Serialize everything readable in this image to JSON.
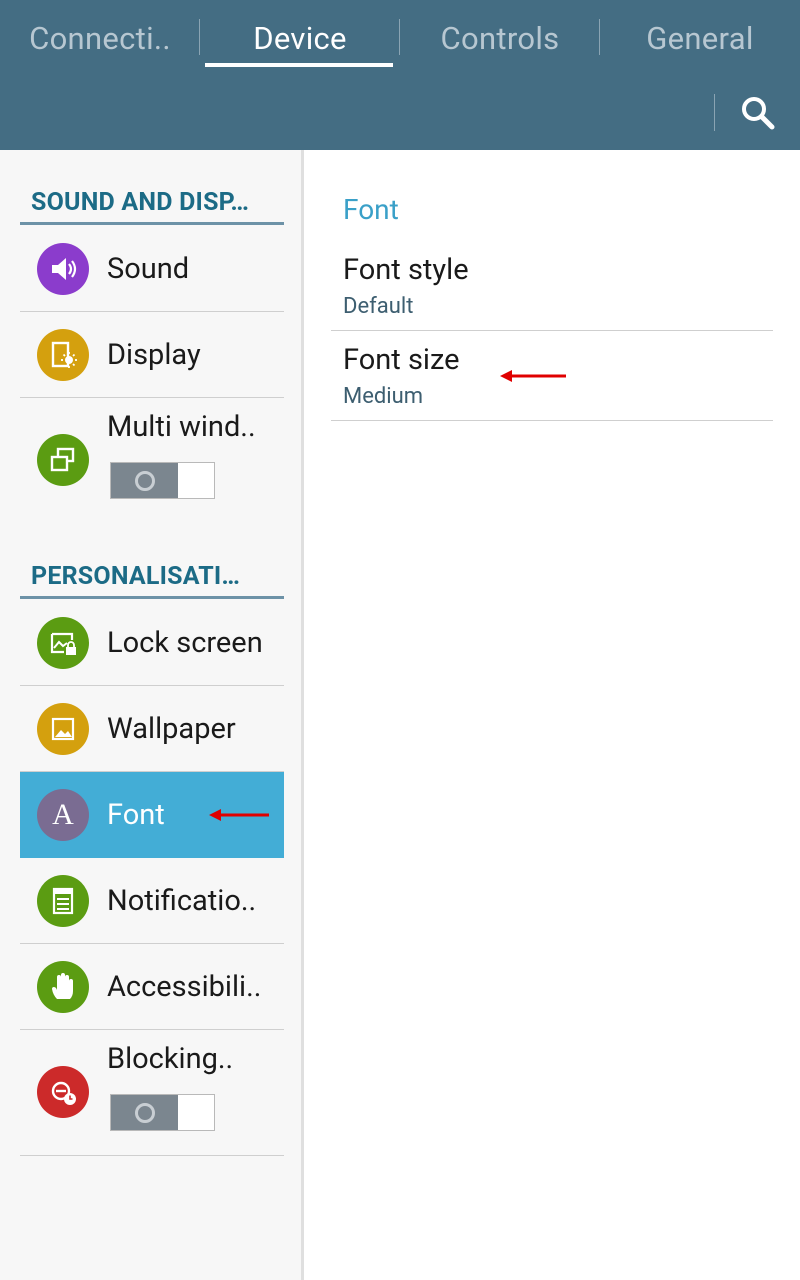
{
  "tabs": [
    {
      "label": "Connecti..",
      "active": false
    },
    {
      "label": "Device",
      "active": true
    },
    {
      "label": "Controls",
      "active": false
    },
    {
      "label": "General",
      "active": false
    }
  ],
  "header": {
    "search_icon": "search-icon"
  },
  "sections": {
    "sound_display": "SOUND AND DISP…",
    "personalisation": "PERSONALISATI…"
  },
  "items": {
    "sound": {
      "label": "Sound",
      "icon": "speaker-icon",
      "color": "#8b3ccc"
    },
    "display": {
      "label": "Display",
      "icon": "display-icon",
      "color": "#d4a00e"
    },
    "multi_window": {
      "label": "Multi wind..",
      "icon": "multi-window-icon",
      "color": "#5b9c12",
      "toggle": "off"
    },
    "lock_screen": {
      "label": "Lock screen",
      "icon": "lock-screen-icon",
      "color": "#5b9c12"
    },
    "wallpaper": {
      "label": "Wallpaper",
      "icon": "wallpaper-icon",
      "color": "#d4a00e"
    },
    "font": {
      "label": "Font",
      "icon": "font-icon",
      "color": "#7a6c92",
      "selected": true
    },
    "notification": {
      "label": "Notificatio..",
      "icon": "notification-icon",
      "color": "#5b9c12"
    },
    "accessibility": {
      "label": "Accessibili..",
      "icon": "hand-icon",
      "color": "#5b9c12"
    },
    "blocking": {
      "label": "Blocking..",
      "icon": "blocking-icon",
      "color": "#cc2a2a",
      "toggle": "off"
    }
  },
  "font_letter": "A",
  "detail": {
    "title": "Font",
    "settings": [
      {
        "title": "Font style",
        "value": "Default"
      },
      {
        "title": "Font size",
        "value": "Medium"
      }
    ]
  },
  "colors": {
    "header": "#446d83",
    "accent": "#43add6",
    "section_text": "#1c6b86",
    "annotation_arrow": "#e00000"
  }
}
